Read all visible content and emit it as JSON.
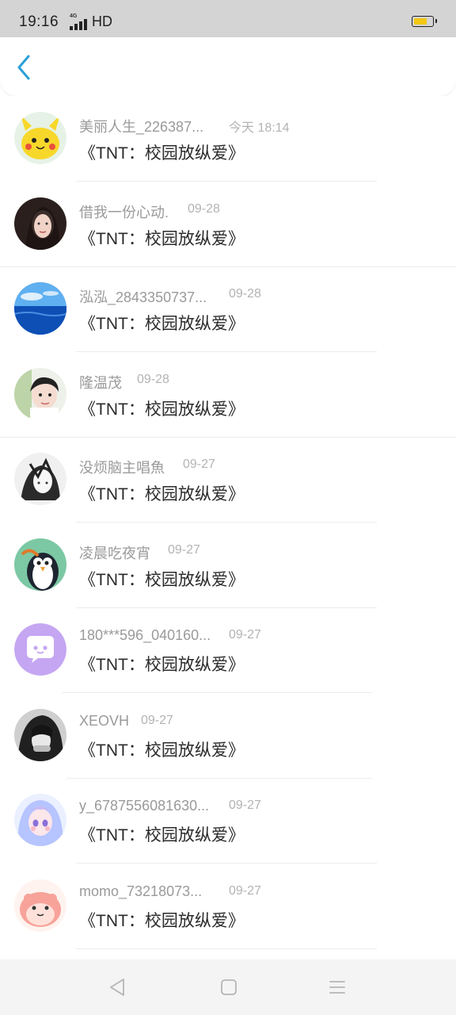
{
  "status_bar": {
    "time": "19:16",
    "network": "4G",
    "hd": "HD",
    "battery_level": 0.75,
    "battery_color": "#f2c813"
  },
  "app_bar": {
    "back_icon": "chevron-left-icon",
    "accent": "#2a9fd8"
  },
  "messages": [
    {
      "name": "美丽人生_226387...",
      "time": "今天 18:14",
      "title": "《TNT：校园放纵爱》",
      "avatar": "pikachu"
    },
    {
      "name": "借我一份心动.",
      "time": "09-28",
      "title": "《TNT：校园放纵爱》",
      "avatar": "girl-portrait"
    },
    {
      "name": "泓泓_2843350737...",
      "time": "09-28",
      "title": "《TNT：校园放纵爱》",
      "avatar": "ocean"
    },
    {
      "name": "隆温茂",
      "time": "09-28",
      "title": "《TNT：校园放纵爱》",
      "avatar": "child"
    },
    {
      "name": "没烦脑主唱魚",
      "time": "09-27",
      "title": "《TNT：校园放纵爱》",
      "avatar": "anime-bw"
    },
    {
      "name": "凌晨吃夜宵",
      "time": "09-27",
      "title": "《TNT：校园放纵爱》",
      "avatar": "penguin"
    },
    {
      "name": "180***596_040160...",
      "time": "09-27",
      "title": "《TNT：校园放纵爱》",
      "avatar": "chat-bubble"
    },
    {
      "name": "XEOVH",
      "time": "09-27",
      "title": "《TNT：校园放纵爱》",
      "avatar": "bw-photo"
    },
    {
      "name": "y_6787556081630...",
      "time": "09-27",
      "title": "《TNT：校园放纵爱》",
      "avatar": "anime-girl"
    },
    {
      "name": "momo_73218073...",
      "time": "09-27",
      "title": "《TNT：校园放纵爱》",
      "avatar": "cartoon-pink"
    }
  ],
  "nav_bar": {
    "back": "triangle-back-icon",
    "home": "square-home-icon",
    "menu": "menu-lines-icon"
  }
}
